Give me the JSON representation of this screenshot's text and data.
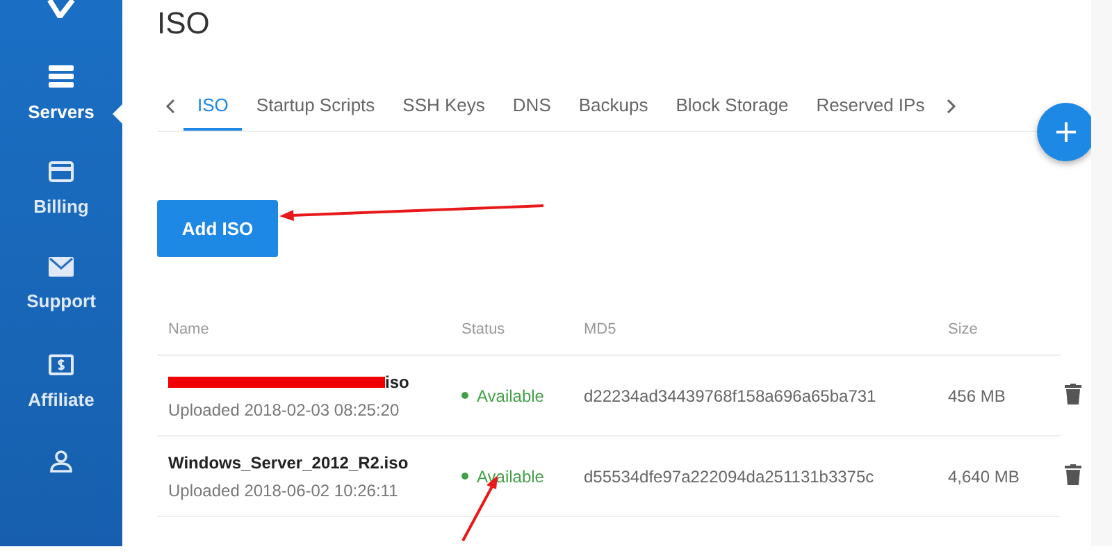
{
  "sidebar": {
    "items": [
      {
        "kind": "servers",
        "label": "Servers",
        "selected": true
      },
      {
        "kind": "billing",
        "label": "Billing",
        "selected": false
      },
      {
        "kind": "support",
        "label": "Support",
        "selected": false
      },
      {
        "kind": "affiliate",
        "label": "Affiliate",
        "selected": false
      },
      {
        "kind": "account",
        "selected": false
      }
    ]
  },
  "page": {
    "title": "ISO"
  },
  "tabs": [
    {
      "label": "ISO",
      "selected": true
    },
    {
      "label": "Startup Scripts",
      "selected": false
    },
    {
      "label": "SSH Keys",
      "selected": false
    },
    {
      "label": "DNS",
      "selected": false
    },
    {
      "label": "Backups",
      "selected": false
    },
    {
      "label": "Block Storage",
      "selected": false
    },
    {
      "label": "Reserved IPs",
      "selected": false
    }
  ],
  "add_button": "Add ISO",
  "table": {
    "columns": [
      "Name",
      "Status",
      "MD5",
      "Size"
    ],
    "rows": [
      {
        "name": "iso",
        "redacted": true,
        "uploaded": "Uploaded 2018-02-03 08:25:20",
        "status": "Available",
        "md5": "d22234ad34439768f158a696a65ba731",
        "size": "456 MB"
      },
      {
        "name": "Windows_Server_2012_R2.iso",
        "redacted": false,
        "uploaded": "Uploaded 2018-06-02 10:26:11",
        "status": "Available",
        "md5": "d55534dfe97a222094da251131b3375c",
        "size": "4,640 MB"
      }
    ]
  }
}
